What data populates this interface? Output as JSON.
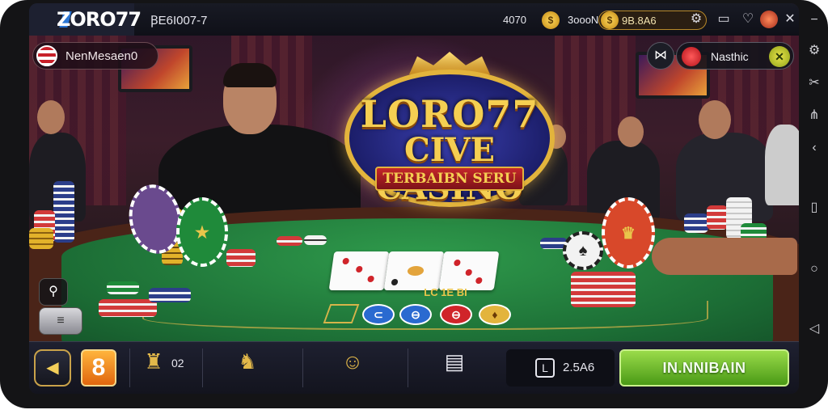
{
  "topbar": {
    "brand": "ZORO77",
    "user_id": "ꞴE6I007-7",
    "stat_a": "4070",
    "stat_b": "3oooN",
    "balance": "9B.8A6"
  },
  "player_pill": {
    "name": "NenMesaen0"
  },
  "notification_pill": {
    "label": "Nasthic"
  },
  "logo": {
    "line1": "LORO77",
    "line2": "CIVE CASINO",
    "ribbon": "TERBAIBN SERU"
  },
  "table": {
    "center_label": "LC 1E BI"
  },
  "bottombar": {
    "badge_number": "8",
    "trophy_count": "02",
    "timer": "2.5A6",
    "play_label": "IN.NNIBAIN"
  },
  "colors": {
    "felt": "#1c6d35",
    "gold": "#e3b43c",
    "play_green": "#4a9a16",
    "badge_orange": "#e0660e"
  }
}
